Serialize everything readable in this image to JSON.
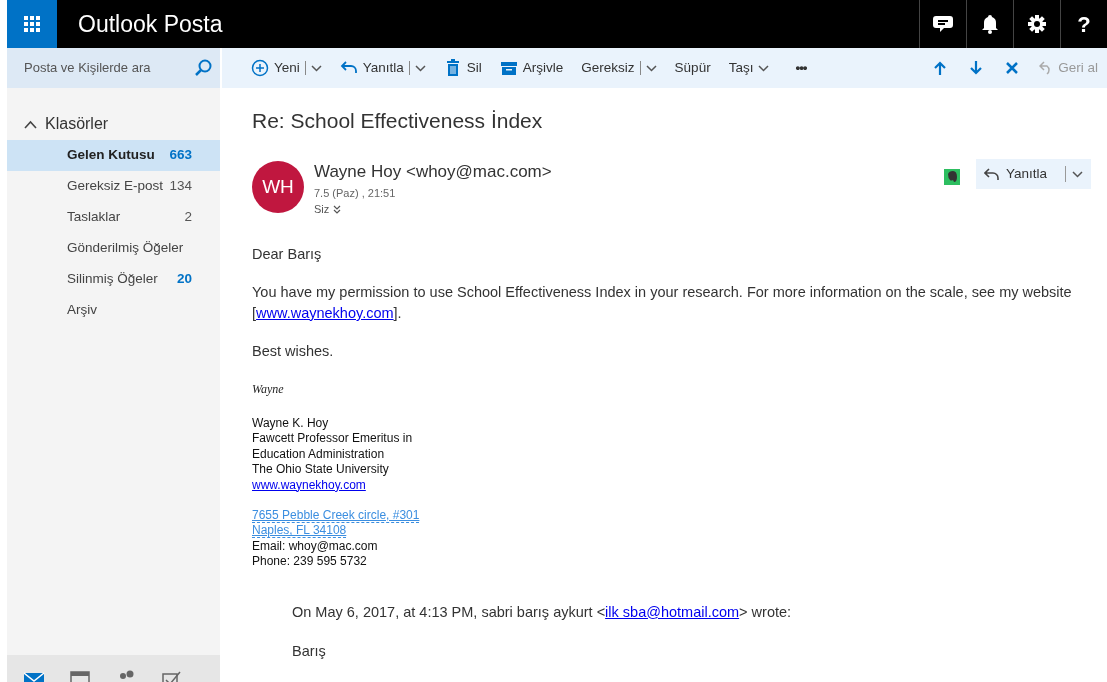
{
  "app": {
    "title": "Outlook Posta",
    "help_label": "?"
  },
  "header_icons": [
    {
      "kind": "chat"
    },
    {
      "kind": "bell"
    },
    {
      "kind": "gear"
    }
  ],
  "search": {
    "placeholder": "Posta ve Kişilerde ara"
  },
  "toolbar": [
    {
      "kind": "new",
      "label": "Yeni",
      "split": true
    },
    {
      "kind": "reply",
      "label": "Yanıtla",
      "split": true
    },
    {
      "kind": "delete",
      "label": "Sil",
      "split": false
    },
    {
      "kind": "archive",
      "label": "Arşivle",
      "split": false
    },
    {
      "kind": "none",
      "label": "Gereksiz",
      "split": true
    },
    {
      "kind": "none",
      "label": "Süpür",
      "split": false
    },
    {
      "kind": "none",
      "label": "Taşı",
      "dropdown": true
    },
    {
      "kind": "more",
      "label": "•••"
    }
  ],
  "nav_buttons": [
    {
      "kind": "up"
    },
    {
      "kind": "down"
    },
    {
      "kind": "close"
    }
  ],
  "undo": {
    "label": "Geri al",
    "disabled": true
  },
  "folders": {
    "label": "Klasörler",
    "expanded": true,
    "items": [
      {
        "name": "Gelen Kutusu",
        "count": "663",
        "unread": true,
        "selected": true
      },
      {
        "name": "Gereksiz E-post",
        "count": "134",
        "unread": false,
        "selected": false
      },
      {
        "name": "Taslaklar",
        "count": "2",
        "unread": false,
        "selected": false
      },
      {
        "name": "Gönderilmiş Öğeler",
        "selected": false
      },
      {
        "name": "Silinmiş Öğeler",
        "count": "20",
        "unread": true,
        "selected": false
      },
      {
        "name": "Arşiv",
        "selected": false
      }
    ]
  },
  "bottom_nav": [
    {
      "kind": "mail",
      "selected": true
    },
    {
      "kind": "calendar",
      "selected": false
    },
    {
      "kind": "people",
      "selected": false
    },
    {
      "kind": "tasks",
      "selected": false
    }
  ],
  "message": {
    "subject": "Re: School Effectiveness İndex",
    "avatar": {
      "initials": "WH",
      "color": "#c0173f"
    },
    "sender": "Wayne Hoy <whoy@mac.com>",
    "date": "7.5 (Paz) , 21:51",
    "to": "Siz",
    "reply_label": "Yanıtla",
    "body": [
      {
        "kind": "text",
        "parts": [
          {
            "text": "Dear Barış"
          }
        ]
      },
      {
        "kind": "text",
        "parts": [
          {
            "text": "You have my permission to use School Effectiveness Index in your research. For more information on the scale, see my website ["
          },
          {
            "link": "www.waynekhoy.com"
          },
          {
            "text": "]."
          }
        ]
      },
      {
        "kind": "text",
        "parts": [
          {
            "text": "Best wishes."
          }
        ]
      }
    ],
    "signature_name": "Wayne",
    "signature_lines": [
      {
        "kind": "text",
        "text": "Wayne K. Hoy"
      },
      {
        "kind": "text",
        "text": "Fawcett Professor Emeritus in"
      },
      {
        "kind": "text",
        "text": "Education Administration"
      },
      {
        "kind": "text",
        "text": "The Ohio State University"
      },
      {
        "kind": "link",
        "text": "www.waynekhoy.com"
      },
      {
        "kind": "gap"
      },
      {
        "kind": "address",
        "text": "7655 Pebble Creek circle, #301"
      },
      {
        "kind": "address",
        "text": "Naples, FL 34108"
      },
      {
        "kind": "text",
        "text": "Email: whoy@mac.com"
      },
      {
        "kind": "text",
        "text": "Phone: 239 595 5732"
      }
    ],
    "quote": {
      "parts": [
        {
          "text": "On May 6, 2017, at 4:13 PM, sabri barış aykurt <"
        },
        {
          "link": "ilk sba@hotmail.com"
        },
        {
          "text": "> wrote:"
        }
      ],
      "greeting": "Barış"
    }
  }
}
